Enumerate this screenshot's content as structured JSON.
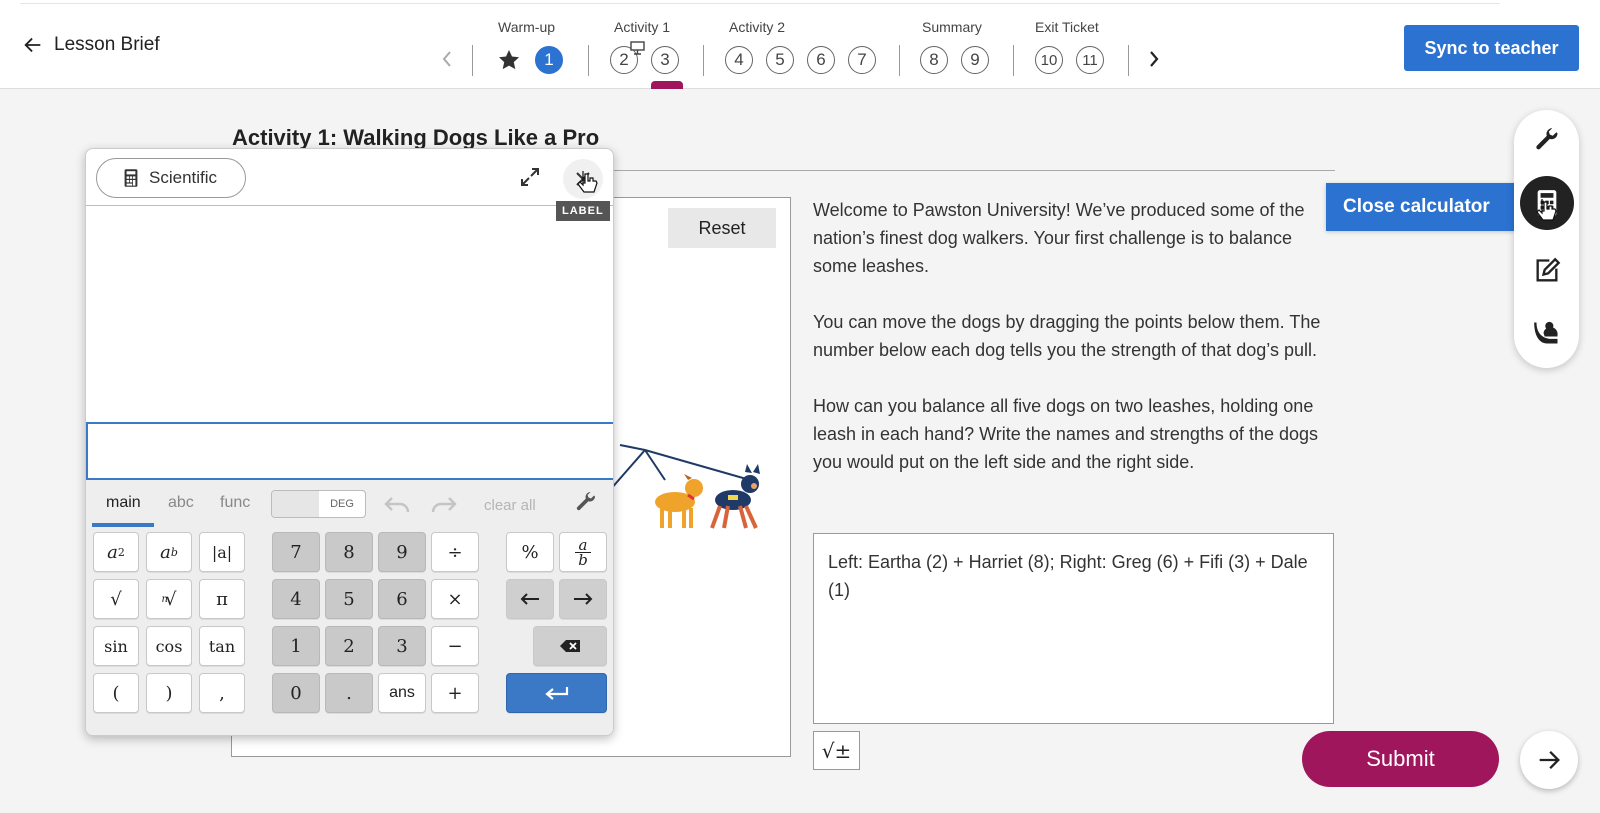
{
  "nav": {
    "back_label": "Lesson Brief",
    "groups": [
      {
        "label": "Warm-up"
      },
      {
        "label": "Activity 1"
      },
      {
        "label": "Activity 2"
      },
      {
        "label": "Summary"
      },
      {
        "label": "Exit Ticket"
      }
    ],
    "steps": [
      "1",
      "2",
      "3",
      "4",
      "5",
      "6",
      "7",
      "8",
      "9",
      "10",
      "11"
    ],
    "active_step": "1",
    "sync_label": "Sync to teacher"
  },
  "activity": {
    "title": "Activity 1: Walking Dogs Like a Pro",
    "reset_label": "Reset",
    "prompt": [
      "Welcome to Pawston University! We’ve produced some of the nation’s finest dog walkers. Your first challenge is to balance some leashes.",
      "You can move the dogs by dragging the points below them. The number below each dog tells you the strength of that dog’s pull.",
      "How can you balance all five dogs on two leashes, holding one leash in each hand? Write the names and strengths of the dogs you would put on the left side and the right side."
    ],
    "answer": "Left: Eartha (2) + Harriet (8); Right: Greg (6) + Fifi (3) + Dale (1)",
    "math_label": "√±",
    "submit_label": "Submit"
  },
  "tools": {
    "close_calculator_label": "Close calculator",
    "items": [
      "wrench-icon",
      "calculator-icon",
      "note-icon",
      "hand-raise-icon"
    ],
    "active": "calculator-icon"
  },
  "calculator": {
    "mode_label": "Scientific",
    "tooltip": "LABEL",
    "input_value": "",
    "tabs": [
      "main",
      "abc",
      "func"
    ],
    "active_tab": "main",
    "angle_unit": "DEG",
    "clear_all_label": "clear all",
    "keys": {
      "num": [
        "7",
        "8",
        "9",
        "4",
        "5",
        "6",
        "1",
        "2",
        "3",
        "0",
        "."
      ],
      "ops": [
        "÷",
        "×",
        "−",
        "+"
      ],
      "funcs": [
        "|a|",
        "π",
        "sin",
        "cos",
        "tan",
        "(",
        ")",
        ","
      ],
      "ans": "ans",
      "percent": "%"
    }
  },
  "colors": {
    "accent_blue": "#2b72d1",
    "submit_magenta": "#a0165d"
  }
}
